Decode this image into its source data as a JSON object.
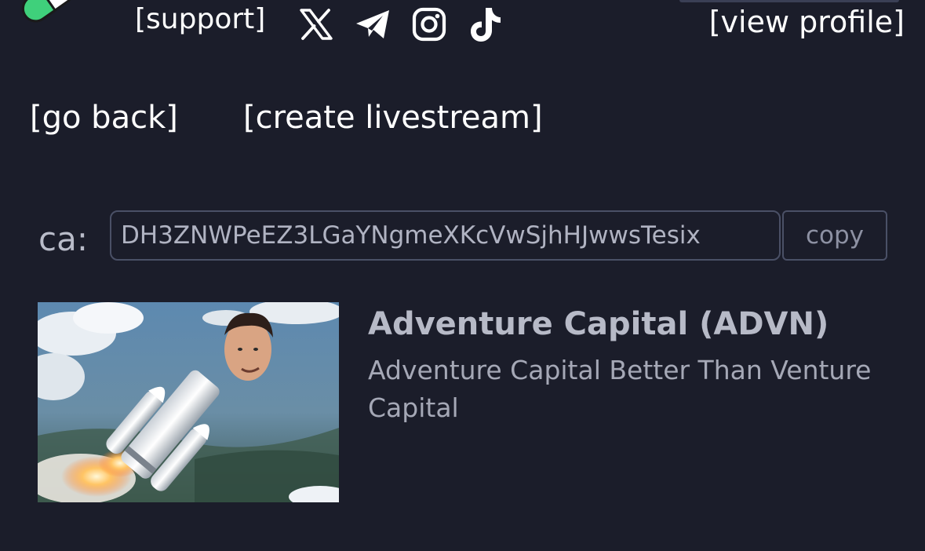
{
  "header": {
    "support_label": "[support]",
    "view_profile_label": "[view profile]",
    "social_icons": [
      "x-icon",
      "telegram-icon",
      "instagram-icon",
      "tiktok-icon"
    ]
  },
  "nav": {
    "go_back_label": "[go back]",
    "create_livestream_label": "[create livestream]"
  },
  "contract": {
    "label": "ca:",
    "address": "DH3ZNWPeEZ3LGaYNgmeXKcVwSjhHJwwsTesix",
    "copy_label": "copy"
  },
  "token": {
    "name": "Adventure Capital (ADVN)",
    "description": "Adventure Capital Better Than Venture Capital"
  },
  "colors": {
    "background": "#1b1d2a",
    "border": "#4a5066",
    "muted_text": "#a5a8b6",
    "logo_green": "#3fd07b"
  }
}
